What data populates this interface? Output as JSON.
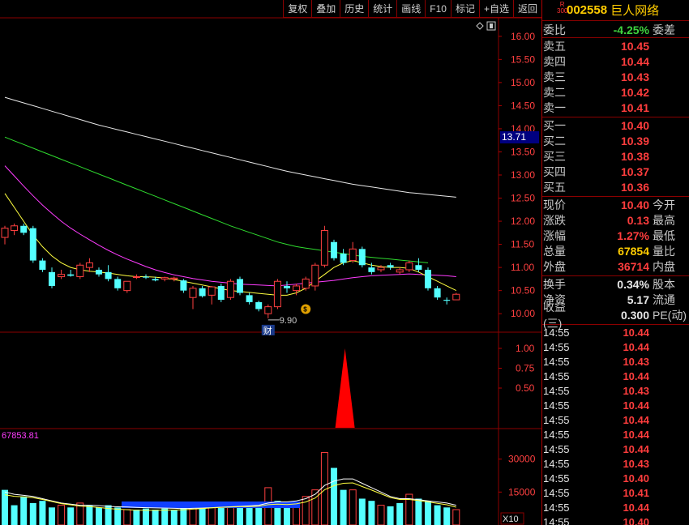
{
  "toolbar": [
    {
      "name": "restore-rights-button",
      "label": "复权"
    },
    {
      "name": "overlay-button",
      "label": "叠加"
    },
    {
      "name": "history-button",
      "label": "历史"
    },
    {
      "name": "stats-button",
      "label": "统计"
    },
    {
      "name": "draw-line-button",
      "label": "画线"
    },
    {
      "name": "f10-button",
      "label": "F10"
    },
    {
      "name": "mark-button",
      "label": "标记"
    },
    {
      "name": "add-watchlist-button",
      "label": "+自选"
    },
    {
      "name": "back-button",
      "label": "返回"
    }
  ],
  "stock": {
    "badge_top": "R",
    "badge_bottom": "300",
    "code": "002558",
    "name": "巨人网络"
  },
  "weibi": {
    "label": "委比",
    "value": "-4.25%",
    "label2": "委差"
  },
  "sell": [
    {
      "label": "卖五",
      "price": "10.45"
    },
    {
      "label": "卖四",
      "price": "10.44"
    },
    {
      "label": "卖三",
      "price": "10.43"
    },
    {
      "label": "卖二",
      "price": "10.42"
    },
    {
      "label": "卖一",
      "price": "10.41"
    }
  ],
  "buy": [
    {
      "label": "买一",
      "price": "10.40"
    },
    {
      "label": "买二",
      "price": "10.39"
    },
    {
      "label": "买三",
      "price": "10.38"
    },
    {
      "label": "买四",
      "price": "10.37"
    },
    {
      "label": "买五",
      "price": "10.36"
    }
  ],
  "quote": [
    {
      "label": "现价",
      "value": "10.40",
      "label2": "今开",
      "color": "red"
    },
    {
      "label": "涨跌",
      "value": "0.13",
      "label2": "最高",
      "color": "red"
    },
    {
      "label": "涨幅",
      "value": "1.27%",
      "label2": "最低",
      "color": "red"
    },
    {
      "label": "总量",
      "value": "67854",
      "label2": "量比",
      "color": "yellow"
    },
    {
      "label": "外盘",
      "value": "36714",
      "label2": "内盘",
      "color": "red"
    }
  ],
  "fundamentals": [
    {
      "label": "换手",
      "value": "0.34%",
      "label2": "股本"
    },
    {
      "label": "净资",
      "value": "5.17",
      "label2": "流通"
    },
    {
      "label": "收益(三)",
      "value": "0.300",
      "label2": "PE(动)"
    }
  ],
  "ticks": [
    {
      "time": "14:55",
      "price": "10.44"
    },
    {
      "time": "14:55",
      "price": "10.44"
    },
    {
      "time": "14:55",
      "price": "10.43"
    },
    {
      "time": "14:55",
      "price": "10.44"
    },
    {
      "time": "14:55",
      "price": "10.43"
    },
    {
      "time": "14:55",
      "price": "10.44"
    },
    {
      "time": "14:55",
      "price": "10.44"
    },
    {
      "time": "14:55",
      "price": "10.44"
    },
    {
      "time": "14:55",
      "price": "10.44"
    },
    {
      "time": "14:55",
      "price": "10.43"
    },
    {
      "time": "14:55",
      "price": "10.40"
    },
    {
      "time": "14:55",
      "price": "10.41"
    },
    {
      "time": "14:55",
      "price": "10.44"
    },
    {
      "time": "14:55",
      "price": "10.40"
    }
  ],
  "chart_data": {
    "type": "candlestick",
    "price_axis": {
      "ticks": [
        "16.00",
        "15.50",
        "15.00",
        "14.50",
        "14.00",
        "13.50",
        "13.00",
        "12.50",
        "12.00",
        "11.50",
        "11.00",
        "10.50",
        "10.00"
      ],
      "ylim": [
        9.6,
        16.4
      ]
    },
    "current_price_marker": "13.71",
    "low_annotation": "9.90",
    "finance_marker": "财",
    "indicator_axis": {
      "ticks": [
        "1.00",
        "0.75",
        "0.50"
      ],
      "ylim": [
        0,
        1.0
      ]
    },
    "volume_axis": {
      "ticks": [
        "30000",
        "15000"
      ],
      "unit_label": "X10",
      "ylim": [
        0,
        38000
      ]
    },
    "volume_readout": "67853.81",
    "candles": [
      {
        "o": 11.65,
        "h": 11.9,
        "l": 11.5,
        "c": 11.85
      },
      {
        "o": 11.8,
        "h": 11.95,
        "l": 11.7,
        "c": 11.9
      },
      {
        "o": 11.9,
        "h": 11.95,
        "l": 11.7,
        "c": 11.75
      },
      {
        "o": 11.85,
        "h": 11.9,
        "l": 11.1,
        "c": 11.15
      },
      {
        "o": 11.15,
        "h": 11.2,
        "l": 10.9,
        "c": 10.95
      },
      {
        "o": 10.9,
        "h": 11.0,
        "l": 10.55,
        "c": 10.6
      },
      {
        "o": 10.8,
        "h": 10.95,
        "l": 10.75,
        "c": 10.85
      },
      {
        "o": 10.85,
        "h": 10.95,
        "l": 10.8,
        "c": 10.82
      },
      {
        "o": 10.8,
        "h": 11.1,
        "l": 10.75,
        "c": 11.05
      },
      {
        "o": 11.0,
        "h": 11.2,
        "l": 10.9,
        "c": 11.1
      },
      {
        "o": 10.95,
        "h": 11.0,
        "l": 10.8,
        "c": 10.85
      },
      {
        "o": 10.9,
        "h": 11.05,
        "l": 10.7,
        "c": 10.75
      },
      {
        "o": 10.75,
        "h": 10.8,
        "l": 10.5,
        "c": 10.55
      },
      {
        "o": 10.5,
        "h": 10.7,
        "l": 10.45,
        "c": 10.7
      },
      {
        "o": 10.8,
        "h": 10.85,
        "l": 10.75,
        "c": 10.8
      },
      {
        "o": 10.8,
        "h": 10.85,
        "l": 10.75,
        "c": 10.78
      },
      {
        "o": 10.75,
        "h": 10.8,
        "l": 10.7,
        "c": 10.72
      },
      {
        "o": 10.75,
        "h": 10.8,
        "l": 10.7,
        "c": 10.78
      },
      {
        "o": 10.75,
        "h": 10.8,
        "l": 10.7,
        "c": 10.77
      },
      {
        "o": 10.72,
        "h": 10.75,
        "l": 10.45,
        "c": 10.5
      },
      {
        "o": 10.35,
        "h": 10.6,
        "l": 10.1,
        "c": 10.55
      },
      {
        "o": 10.55,
        "h": 10.6,
        "l": 10.35,
        "c": 10.38
      },
      {
        "o": 10.4,
        "h": 10.6,
        "l": 10.2,
        "c": 10.58
      },
      {
        "o": 10.6,
        "h": 10.65,
        "l": 10.25,
        "c": 10.3
      },
      {
        "o": 10.35,
        "h": 10.75,
        "l": 10.3,
        "c": 10.7
      },
      {
        "o": 10.75,
        "h": 10.8,
        "l": 10.4,
        "c": 10.45
      },
      {
        "o": 10.4,
        "h": 10.45,
        "l": 10.2,
        "c": 10.25
      },
      {
        "o": 10.25,
        "h": 10.28,
        "l": 10.05,
        "c": 10.1
      },
      {
        "o": 10.0,
        "h": 10.2,
        "l": 9.9,
        "c": 10.15
      },
      {
        "o": 10.15,
        "h": 10.75,
        "l": 10.1,
        "c": 10.7
      },
      {
        "o": 10.6,
        "h": 10.7,
        "l": 10.45,
        "c": 10.55
      },
      {
        "o": 10.5,
        "h": 10.65,
        "l": 10.4,
        "c": 10.6
      },
      {
        "o": 10.55,
        "h": 10.8,
        "l": 10.5,
        "c": 10.75
      },
      {
        "o": 10.6,
        "h": 11.1,
        "l": 10.5,
        "c": 11.05
      },
      {
        "o": 11.05,
        "h": 11.9,
        "l": 11.0,
        "c": 11.8
      },
      {
        "o": 11.55,
        "h": 11.6,
        "l": 11.15,
        "c": 11.2
      },
      {
        "o": 11.3,
        "h": 11.4,
        "l": 11.05,
        "c": 11.1
      },
      {
        "o": 11.15,
        "h": 11.55,
        "l": 11.1,
        "c": 11.4
      },
      {
        "o": 11.4,
        "h": 11.45,
        "l": 11.0,
        "c": 11.05
      },
      {
        "o": 11.0,
        "h": 11.1,
        "l": 10.85,
        "c": 10.9
      },
      {
        "o": 10.95,
        "h": 11.05,
        "l": 10.9,
        "c": 11.0
      },
      {
        "o": 11.05,
        "h": 11.1,
        "l": 10.95,
        "c": 11.0
      },
      {
        "o": 10.9,
        "h": 11.0,
        "l": 10.85,
        "c": 10.95
      },
      {
        "o": 10.95,
        "h": 11.15,
        "l": 10.9,
        "c": 11.1
      },
      {
        "o": 11.05,
        "h": 11.2,
        "l": 10.9,
        "c": 10.95
      },
      {
        "o": 10.95,
        "h": 11.0,
        "l": 10.5,
        "c": 10.55
      },
      {
        "o": 10.55,
        "h": 10.6,
        "l": 10.3,
        "c": 10.35
      },
      {
        "o": 10.3,
        "h": 10.35,
        "l": 10.2,
        "c": 10.28
      },
      {
        "o": 10.3,
        "h": 10.45,
        "l": 10.3,
        "c": 10.42
      }
    ],
    "series": [
      {
        "color": "#e8e8e8",
        "values": [
          14.68,
          14.62,
          14.56,
          14.5,
          14.44,
          14.38,
          14.32,
          14.26,
          14.2,
          14.14,
          14.08,
          14.03,
          13.98,
          13.93,
          13.88,
          13.83,
          13.78,
          13.73,
          13.68,
          13.63,
          13.58,
          13.53,
          13.48,
          13.43,
          13.38,
          13.33,
          13.28,
          13.23,
          13.18,
          13.13,
          13.08,
          13.04,
          13.0,
          12.96,
          12.92,
          12.88,
          12.84,
          12.8,
          12.77,
          12.74,
          12.71,
          12.68,
          12.65,
          12.62,
          12.6,
          12.58,
          12.56,
          12.54,
          12.52
        ]
      },
      {
        "color": "#2fdc2f",
        "values": [
          13.82,
          13.74,
          13.66,
          13.58,
          13.5,
          13.42,
          13.34,
          13.26,
          13.18,
          13.1,
          13.02,
          12.94,
          12.86,
          12.78,
          12.7,
          12.62,
          12.54,
          12.46,
          12.38,
          12.3,
          12.22,
          12.14,
          12.06,
          11.98,
          11.9,
          11.83,
          11.76,
          11.69,
          11.62,
          11.55,
          11.5,
          11.45,
          11.42,
          11.39,
          11.36,
          11.33,
          11.3,
          11.27,
          11.24,
          11.22,
          11.2,
          11.18,
          11.16,
          11.14,
          11.12,
          11.1
        ]
      },
      {
        "color": "#ff3cff",
        "values": [
          13.2,
          12.98,
          12.76,
          12.55,
          12.35,
          12.17,
          12.0,
          11.85,
          11.72,
          11.6,
          11.48,
          11.37,
          11.27,
          11.18,
          11.1,
          11.02,
          10.95,
          10.89,
          10.84,
          10.8,
          10.76,
          10.73,
          10.7,
          10.68,
          10.66,
          10.64,
          10.63,
          10.62,
          10.61,
          10.6,
          10.62,
          10.64,
          10.66,
          10.68,
          10.7,
          10.72,
          10.75,
          10.78,
          10.8,
          10.82,
          10.83,
          10.84,
          10.85,
          10.86,
          10.85,
          10.84,
          10.83,
          10.82,
          10.8
        ]
      },
      {
        "color": "#ffff40",
        "values": [
          12.6,
          12.3,
          12.0,
          11.7,
          11.45,
          11.25,
          11.1,
          11.0,
          10.95,
          10.92,
          10.9,
          10.88,
          10.85,
          10.82,
          10.8,
          10.8,
          10.79,
          10.77,
          10.74,
          10.7,
          10.66,
          10.62,
          10.58,
          10.54,
          10.5,
          10.48,
          10.46,
          10.44,
          10.42,
          10.4,
          10.4,
          10.45,
          10.55,
          10.7,
          10.85,
          11.0,
          11.1,
          11.15,
          11.1,
          11.05,
          11.02,
          11.0,
          11.0,
          10.98,
          10.9,
          10.8,
          10.7,
          10.6,
          10.5
        ]
      }
    ],
    "indicator_spike": {
      "index": 36,
      "value": 1.0
    },
    "volumes": [
      {
        "v": 16000,
        "up": false
      },
      {
        "v": 9000,
        "up": false
      },
      {
        "v": 13000,
        "up": false
      },
      {
        "v": 10000,
        "up": false
      },
      {
        "v": 11000,
        "up": false
      },
      {
        "v": 8000,
        "up": false
      },
      {
        "v": 9000,
        "up": true
      },
      {
        "v": 8000,
        "up": false
      },
      {
        "v": 10000,
        "up": true
      },
      {
        "v": 9000,
        "up": false
      },
      {
        "v": 8000,
        "up": false
      },
      {
        "v": 9000,
        "up": false
      },
      {
        "v": 8000,
        "up": false
      },
      {
        "v": 7000,
        "up": true
      },
      {
        "v": 7000,
        "up": false
      },
      {
        "v": 7500,
        "up": false
      },
      {
        "v": 7000,
        "up": false
      },
      {
        "v": 7500,
        "up": false
      },
      {
        "v": 7000,
        "up": false
      },
      {
        "v": 8000,
        "up": false
      },
      {
        "v": 9000,
        "up": true
      },
      {
        "v": 8000,
        "up": false
      },
      {
        "v": 9000,
        "up": true
      },
      {
        "v": 8000,
        "up": false
      },
      {
        "v": 9000,
        "up": true
      },
      {
        "v": 8000,
        "up": false
      },
      {
        "v": 9000,
        "up": false
      },
      {
        "v": 8500,
        "up": false
      },
      {
        "v": 17000,
        "up": true
      },
      {
        "v": 11000,
        "up": false
      },
      {
        "v": 9000,
        "up": false
      },
      {
        "v": 10000,
        "up": true
      },
      {
        "v": 13000,
        "up": true
      },
      {
        "v": 16000,
        "up": true
      },
      {
        "v": 33000,
        "up": true
      },
      {
        "v": 26000,
        "up": false
      },
      {
        "v": 16000,
        "up": false
      },
      {
        "v": 16000,
        "up": true
      },
      {
        "v": 12000,
        "up": false
      },
      {
        "v": 11000,
        "up": false
      },
      {
        "v": 9000,
        "up": true
      },
      {
        "v": 8500,
        "up": false
      },
      {
        "v": 10000,
        "up": false
      },
      {
        "v": 14000,
        "up": true
      },
      {
        "v": 12000,
        "up": false
      },
      {
        "v": 11000,
        "up": false
      },
      {
        "v": 9000,
        "up": false
      },
      {
        "v": 8000,
        "up": false
      },
      {
        "v": 7000,
        "up": true
      }
    ]
  }
}
